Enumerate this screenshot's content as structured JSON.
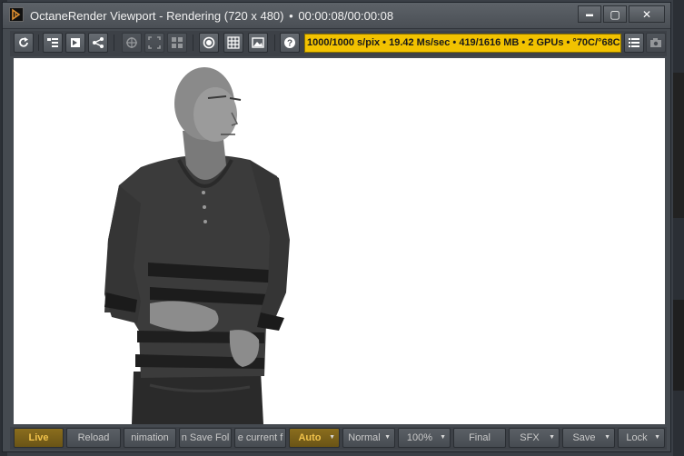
{
  "window": {
    "app_name": "OctaneRender Viewport",
    "title_sep": "-",
    "state": "Rendering",
    "resolution": "(720 x 480)",
    "bullet": "•",
    "time": "00:00:08/00:00:08",
    "controls": {
      "minimize": "▬",
      "maximize": "▢",
      "close": "✕"
    }
  },
  "toolbar": {
    "status_text": "1000/1000 s/pix • 19.42 Ms/sec • 419/1616 MB • 2 GPUs • °70C/°68C",
    "icons": [
      "refresh-icon",
      "outline-icon",
      "pick-icon",
      "share-icon",
      "focus-picker-icon",
      "region-icon",
      "grid-view-icon",
      "record-icon",
      "grid-icon",
      "image-icon",
      "help-icon",
      "list-icon",
      "camera-icon"
    ]
  },
  "bottombar": {
    "live": "Live",
    "reload": "Reload",
    "animation": "nimation",
    "save_folder": "n Save Fol",
    "current_frame": "e current f",
    "auto": "Auto",
    "normal": "Normal",
    "zoom": "100%",
    "final": "Final",
    "sfx": "SFX",
    "save": "Save",
    "lock": "Lock"
  },
  "colors": {
    "status_bg": "#f2c200",
    "live_text": "#f1c24a",
    "window_bg": "#454a50"
  }
}
